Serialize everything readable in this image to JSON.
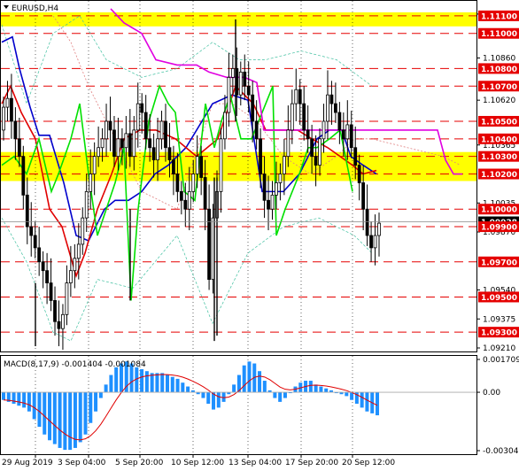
{
  "window": {
    "symbol_label": "EURUSD,H4"
  },
  "indicator": {
    "label": "MACD(8,17,9) -0.001404 -0.001084"
  },
  "colors": {
    "red_level": "#e50000",
    "yellow_zone": "#ffff00",
    "green_line": "#00e000",
    "red_line": "#e00000",
    "blue_line": "#0000cc",
    "magenta_line": "#e000e0",
    "macd_bar": "#1e90ff",
    "macd_signal": "#e00000"
  },
  "price_axis": {
    "ticks": [
      "1.11110",
      "1.10860",
      "1.10620",
      "1.10365",
      "1.10035",
      "1.09870",
      "1.09540",
      "1.09375",
      "1.09210"
    ],
    "min": 1.092,
    "max": 1.1118
  },
  "levels": [
    {
      "label": "1.11100",
      "value": 1.111
    },
    {
      "label": "1.11000",
      "value": 1.11
    },
    {
      "label": "1.10800",
      "value": 1.108
    },
    {
      "label": "1.10700",
      "value": 1.107
    },
    {
      "label": "1.10500",
      "value": 1.105
    },
    {
      "label": "1.10400",
      "value": 1.104
    },
    {
      "label": "1.10300",
      "value": 1.103
    },
    {
      "label": "1.10200",
      "value": 1.102
    },
    {
      "label": "1.10000",
      "value": 1.1
    },
    {
      "label": "1.09900",
      "value": 1.099
    },
    {
      "label": "1.09700",
      "value": 1.097
    },
    {
      "label": "1.09500",
      "value": 1.095
    },
    {
      "label": "1.09300",
      "value": 1.093
    }
  ],
  "current_price": {
    "label": "1.09928",
    "value": 1.09928
  },
  "macd_axis": {
    "ticks": [
      "0.001709",
      "0.00",
      "-0.003041"
    ]
  },
  "time_axis": {
    "labels": [
      "29 Aug 2019",
      "3 Sep 04:00",
      "5 Sep 20:00",
      "10 Sep 12:00",
      "13 Sep 04:00",
      "17 Sep 20:00",
      "20 Sep 12:00"
    ]
  }
}
